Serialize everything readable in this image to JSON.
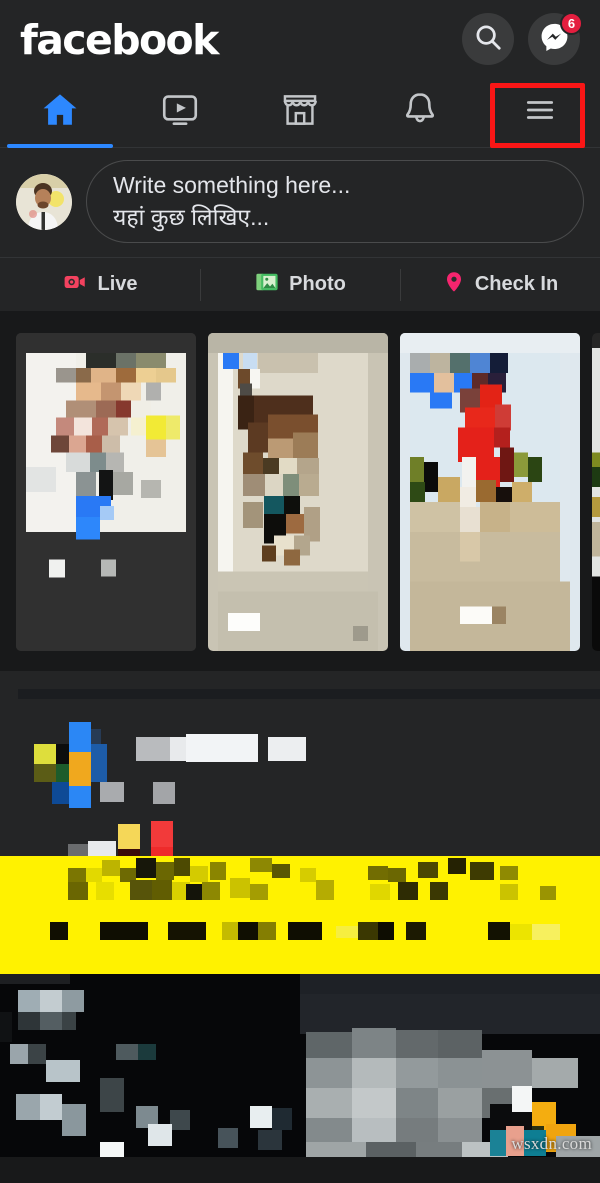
{
  "app": {
    "brand": "facebook",
    "theme_background": "#18191a",
    "surface": "#242526",
    "accent_blue": "#2d88ff",
    "highlight_box_color": "#f91616"
  },
  "header": {
    "logo_text": "facebook",
    "search": {
      "icon": "search-icon",
      "label": "Search"
    },
    "messenger": {
      "icon": "messenger-icon",
      "label": "Messenger",
      "badge_count": "6",
      "badge_color": "#e41e3f"
    }
  },
  "nav_tabs": [
    {
      "id": "home",
      "icon": "home-icon",
      "label": "Home",
      "active": true
    },
    {
      "id": "watch",
      "icon": "video-play-icon",
      "label": "Watch",
      "active": false
    },
    {
      "id": "marketplace",
      "icon": "store-icon",
      "label": "Marketplace",
      "active": false
    },
    {
      "id": "notifications",
      "icon": "bell-icon",
      "label": "Notifications",
      "active": false
    },
    {
      "id": "menu",
      "icon": "hamburger-menu-icon",
      "label": "Menu",
      "active": false,
      "highlighted": true
    }
  ],
  "composer": {
    "avatar": "user-avatar",
    "placeholder_line1": "Write something here...",
    "placeholder_line2": "यहां कुछ लिखिए..."
  },
  "composer_actions": [
    {
      "id": "live",
      "label": "Live",
      "icon": "live-video-icon",
      "color": "#f3425f"
    },
    {
      "id": "photo",
      "label": "Photo",
      "icon": "photo-icon",
      "color": "#45bd62"
    },
    {
      "id": "checkin",
      "label": "Check In",
      "icon": "location-pin-icon",
      "color": "#f5256e"
    }
  ],
  "stories": [
    {
      "id": "story-1",
      "censored": true
    },
    {
      "id": "story-2",
      "censored": true
    },
    {
      "id": "story-3",
      "censored": true
    },
    {
      "id": "story-4",
      "censored": true,
      "partial": true
    }
  ],
  "feed_post": {
    "author_censored": true,
    "banner_color": "#fff200",
    "banner_text_censored": true,
    "image_censored": true
  },
  "watermark": {
    "text": "wsxdn.com"
  }
}
